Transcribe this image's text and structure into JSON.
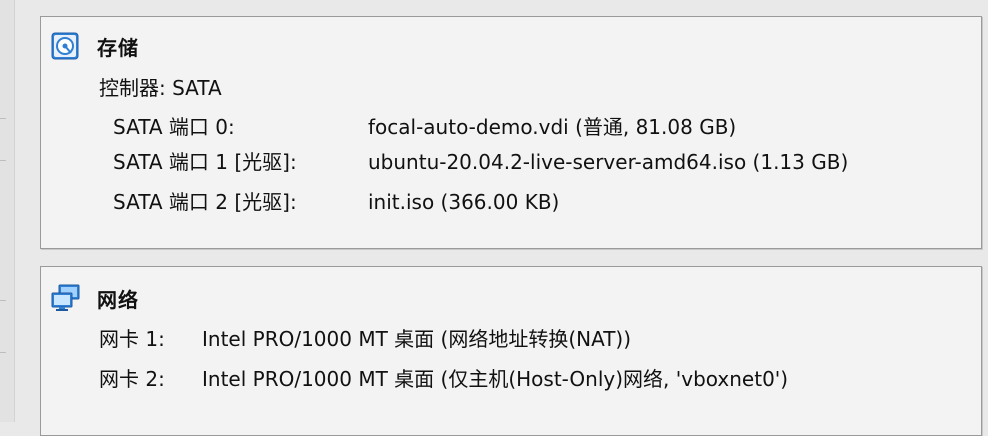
{
  "storage": {
    "title": "存储",
    "icon": "storage-disk-icon",
    "controller": "控制器: SATA",
    "ports": [
      {
        "label": "SATA 端口 0:",
        "value": "focal-auto-demo.vdi (普通, 81.08 GB)"
      },
      {
        "label": "SATA 端口 1 [光驱]:",
        "value": "ubuntu-20.04.2-live-server-amd64.iso (1.13 GB)"
      },
      {
        "label": "SATA 端口 2 [光驱]:",
        "value": "init.iso (366.00 KB)"
      }
    ]
  },
  "network": {
    "title": "网络",
    "icon": "network-monitors-icon",
    "adapters": [
      {
        "label": "网卡 1:",
        "value": "Intel PRO/1000 MT 桌面 (网络地址转换(NAT))"
      },
      {
        "label": "网卡 2:",
        "value": "Intel PRO/1000 MT 桌面 (仅主机(Host-Only)网络, 'vboxnet0')"
      }
    ]
  },
  "colors": {
    "icon_blue": "#2f7fd4",
    "panel_bg": "#f3f3f3",
    "panel_border": "#9a9a9a"
  }
}
